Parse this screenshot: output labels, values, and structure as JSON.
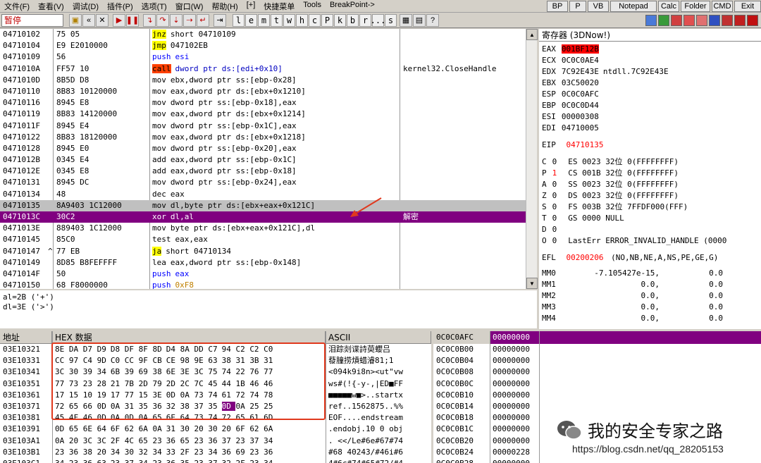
{
  "menu": {
    "items": [
      "文件(F)",
      "查看(V)",
      "调试(D)",
      "插件(P)",
      "选项(T)",
      "窗口(W)",
      "帮助(H)",
      "[+]",
      "快捷菜单",
      "Tools",
      "BreakPoint->"
    ],
    "right_buttons": [
      "BP",
      "P",
      "VB",
      "Notepad",
      "Calc",
      "Folder",
      "CMD",
      "Exit"
    ]
  },
  "toolbar": {
    "status": "暂停",
    "letters": [
      "l",
      "e",
      "m",
      "t",
      "w",
      "h",
      "c",
      "P",
      "k",
      "b",
      "r",
      "...",
      "s"
    ]
  },
  "disasm": {
    "rows": [
      {
        "addr": "04710102",
        "mark": "",
        "hex": "75 05",
        "mn": "jnz",
        "ops": "short 04710109",
        "cmt": "",
        "style": "jmp"
      },
      {
        "addr": "04710104",
        "mark": "",
        "hex": "E9 E2010000",
        "mn": "jmp",
        "ops": "047102EB",
        "cmt": "",
        "style": "jmp"
      },
      {
        "addr": "04710109",
        "mark": "",
        "hex": "56",
        "mn": "push",
        "ops": "esi",
        "cmt": "",
        "style": "push"
      },
      {
        "addr": "0471010A",
        "mark": "",
        "hex": "FF57 10",
        "mn": "call",
        "ops": "dword ptr ds:[edi+0x10]",
        "cmt": "kernel32.CloseHandle",
        "style": "call"
      },
      {
        "addr": "0471010D",
        "mark": "",
        "hex": "8B5D D8",
        "mn": "mov",
        "ops": "ebx,dword ptr ss:[ebp-0x28]",
        "cmt": "",
        "style": ""
      },
      {
        "addr": "04710110",
        "mark": "",
        "hex": "8B83 10120000",
        "mn": "mov",
        "ops": "eax,dword ptr ds:[ebx+0x1210]",
        "cmt": "",
        "style": ""
      },
      {
        "addr": "04710116",
        "mark": "",
        "hex": "8945 E8",
        "mn": "mov",
        "ops": "dword ptr ss:[ebp-0x18],eax",
        "cmt": "",
        "style": ""
      },
      {
        "addr": "04710119",
        "mark": "",
        "hex": "8B83 14120000",
        "mn": "mov",
        "ops": "eax,dword ptr ds:[ebx+0x1214]",
        "cmt": "",
        "style": ""
      },
      {
        "addr": "0471011F",
        "mark": "",
        "hex": "8945 E4",
        "mn": "mov",
        "ops": "dword ptr ss:[ebp-0x1C],eax",
        "cmt": "",
        "style": ""
      },
      {
        "addr": "04710122",
        "mark": "",
        "hex": "8B83 18120000",
        "mn": "mov",
        "ops": "eax,dword ptr ds:[ebx+0x1218]",
        "cmt": "",
        "style": ""
      },
      {
        "addr": "04710128",
        "mark": "",
        "hex": "8945 E0",
        "mn": "mov",
        "ops": "dword ptr ss:[ebp-0x20],eax",
        "cmt": "",
        "style": ""
      },
      {
        "addr": "0471012B",
        "mark": "",
        "hex": "0345 E4",
        "mn": "add",
        "ops": "eax,dword ptr ss:[ebp-0x1C]",
        "cmt": "",
        "style": ""
      },
      {
        "addr": "0471012E",
        "mark": "",
        "hex": "0345 E8",
        "mn": "add",
        "ops": "eax,dword ptr ss:[ebp-0x18]",
        "cmt": "",
        "style": ""
      },
      {
        "addr": "04710131",
        "mark": "",
        "hex": "8945 DC",
        "mn": "mov",
        "ops": "dword ptr ss:[ebp-0x24],eax",
        "cmt": "",
        "style": ""
      },
      {
        "addr": "04710134",
        "mark": "",
        "hex": "48",
        "mn": "dec",
        "ops": "eax",
        "cmt": "",
        "style": ""
      },
      {
        "addr": "04710135",
        "mark": "",
        "hex": "8A9403 1C12000",
        "mn": "mov",
        "ops": "dl,byte ptr ds:[ebx+eax+0x121C]",
        "cmt": "",
        "style": "cur"
      },
      {
        "addr": "0471013C",
        "mark": "",
        "hex": "30C2",
        "mn": "xor",
        "ops": "dl,al",
        "cmt": "解密",
        "style": "sel"
      },
      {
        "addr": "0471013E",
        "mark": "",
        "hex": "889403 1C12000",
        "mn": "mov",
        "ops": "byte ptr ds:[ebx+eax+0x121C],dl",
        "cmt": "",
        "style": ""
      },
      {
        "addr": "04710145",
        "mark": "",
        "hex": "85C0",
        "mn": "test",
        "ops": "eax,eax",
        "cmt": "",
        "style": ""
      },
      {
        "addr": "04710147",
        "mark": "^",
        "hex": "77 EB",
        "mn": "ja",
        "ops": "short 04710134",
        "cmt": "",
        "style": "jmp"
      },
      {
        "addr": "04710149",
        "mark": "",
        "hex": "8D85 B8FEFFFF",
        "mn": "lea",
        "ops": "eax,dword ptr ss:[ebp-0x148]",
        "cmt": "",
        "style": ""
      },
      {
        "addr": "0471014F",
        "mark": "",
        "hex": "50",
        "mn": "push",
        "ops": "eax",
        "cmt": "",
        "style": "push"
      },
      {
        "addr": "04710150",
        "mark": "",
        "hex": "68 F8000000",
        "mn": "push",
        "ops": "0xF8",
        "cmt": "",
        "style": "push"
      }
    ]
  },
  "info": {
    "line1": "al=2B ('+')",
    "line2": "dl=3E ('>')"
  },
  "registers": {
    "title": "寄存器 (3DNow!)",
    "gp": [
      {
        "name": "EAX",
        "value": "001BF12B",
        "extra": "",
        "hl": true
      },
      {
        "name": "ECX",
        "value": "0C0C0AE4",
        "extra": "",
        "hl": false
      },
      {
        "name": "EDX",
        "value": "7C92E43E",
        "extra": "ntdll.7C92E43E",
        "hl": false
      },
      {
        "name": "EBX",
        "value": "03C50020",
        "extra": "",
        "hl": false
      },
      {
        "name": "ESP",
        "value": "0C0C0AFC",
        "extra": "",
        "hl": false
      },
      {
        "name": "EBP",
        "value": "0C0C0D44",
        "extra": "",
        "hl": false
      },
      {
        "name": "ESI",
        "value": "00000308",
        "extra": "",
        "hl": false
      },
      {
        "name": "EDI",
        "value": "04710005",
        "extra": "",
        "hl": false
      }
    ],
    "eip_name": "EIP",
    "eip": "04710135",
    "flags": [
      {
        "f": "C",
        "v": "0",
        "seg": "ES 0023 32位 0(FFFFFFFF)"
      },
      {
        "f": "P",
        "v": "1",
        "seg": "CS 001B 32位 0(FFFFFFFF)"
      },
      {
        "f": "A",
        "v": "0",
        "seg": "SS 0023 32位 0(FFFFFFFF)"
      },
      {
        "f": "Z",
        "v": "0",
        "seg": "DS 0023 32位 0(FFFFFFFF)"
      },
      {
        "f": "S",
        "v": "0",
        "seg": "FS 003B 32位 7FFDF000(FFF)"
      },
      {
        "f": "T",
        "v": "0",
        "seg": "GS 0000 NULL"
      },
      {
        "f": "D",
        "v": "0",
        "seg": ""
      },
      {
        "f": "O",
        "v": "0",
        "seg": "LastErr ERROR_INVALID_HANDLE (0000"
      }
    ],
    "efl_name": "EFL",
    "efl": "00200206",
    "efl_desc": "(NO,NB,NE,A,NS,PE,GE,G)",
    "mm": [
      {
        "name": "MM0",
        "a": "-7.105427e-15,",
        "b": "0.0"
      },
      {
        "name": "MM1",
        "a": "0.0,",
        "b": "0.0"
      },
      {
        "name": "MM2",
        "a": "0.0,",
        "b": "0.0"
      },
      {
        "name": "MM3",
        "a": "0.0,",
        "b": "0.0"
      },
      {
        "name": "MM4",
        "a": "0.0,",
        "b": "0.0"
      }
    ]
  },
  "hex": {
    "col_addr": "地址",
    "col_hex": "HEX 数据",
    "col_ascii": "ASCII",
    "rows": [
      {
        "addr": "03E10321",
        "bytes": "8E DA D7 D9|D8 DF 8F 8D|D4 8A DD C7|94 C2 C2 C0",
        "ascii": "泪踪剡谍詩萸蠳吕"
      },
      {
        "addr": "03E10331",
        "bytes": "CC 97 C4 9D|C0 CC 9F CB|CE 98 9E 63|38 31 3B 31",
        "ascii": "蕟膧捞熕蜡濬81;1"
      },
      {
        "addr": "03E10341",
        "bytes": "3C 30 39 34|6B 39 69 38|6E 3E 3C 75|74 22 76 77",
        "ascii": "<094k9i8n><ut\"vw"
      },
      {
        "addr": "03E10351",
        "bytes": "77 73 23 28|21 7B 2D 79|2D 2C 7C 45|44 1B 46 46",
        "ascii": "ws#(!{-y-,|ED■FF"
      },
      {
        "addr": "03E10361",
        "bytes": "17 15 10 19|17 77 15 3E|0D 0A 73 74|61 72 74 78",
        "ascii": "■■■■■w■>..startx"
      },
      {
        "addr": "03E10371",
        "bytes": "72 65 66 0D|0A 31 35 36|32 38 37 35|0D 0A 25 25",
        "ascii": "ref..1562875..%%"
      },
      {
        "addr": "03E10381",
        "bytes": "45 4F 46 0D|0A 0D 0A 65|6E 64 73 74|72 65 61 6D",
        "ascii": "EOF....endstream"
      },
      {
        "addr": "03E10391",
        "bytes": "0D 65 6E 64|6F 62 6A 0A|31 30 20 30|20 6F 62 6A",
        "ascii": ".endobj.10 0 obj"
      },
      {
        "addr": "03E103A1",
        "bytes": "0A 20 3C 3C|2F 4C 65 23|36 65 23 36|37 23 37 34",
        "ascii": ". <</Le#6e#67#74"
      },
      {
        "addr": "03E103B1",
        "bytes": "23 36 38 20|34 30 32 34|33 2F 23 34|36 69 23 36",
        "ascii": "#68 40243/#46i#6"
      },
      {
        "addr": "03E103C1",
        "bytes": "34 23 36 63|23 37 34 23|36 35 23 37|32 2F 23 34",
        "ascii": "4#6c#74#65#72/#4"
      }
    ]
  },
  "stack": {
    "top_addr": "0C0C0AFC",
    "top_val": "00000000",
    "rows": [
      {
        "addr": "0C0C0B00",
        "val": "00000000"
      },
      {
        "addr": "0C0C0B04",
        "val": "00000000"
      },
      {
        "addr": "0C0C0B08",
        "val": "00000000"
      },
      {
        "addr": "0C0C0B0C",
        "val": "00000000"
      },
      {
        "addr": "0C0C0B10",
        "val": "00000000"
      },
      {
        "addr": "0C0C0B14",
        "val": "00000000"
      },
      {
        "addr": "0C0C0B18",
        "val": "00000000"
      },
      {
        "addr": "0C0C0B1C",
        "val": "00000000"
      },
      {
        "addr": "0C0C0B20",
        "val": "00000000"
      },
      {
        "addr": "0C0C0B24",
        "val": "00000228"
      },
      {
        "addr": "0C0C0B28",
        "val": "00000000"
      }
    ]
  },
  "watermark": {
    "text": "我的安全专家之路",
    "url": "https://blog.csdn.net/qq_28205153"
  },
  "colors": {
    "selection": "#800080",
    "eax_highlight": "#ff0000",
    "annotation": "#e0391e"
  },
  "icons": [
    "open-icon",
    "rewind-icon",
    "close-icon",
    "run-icon",
    "pause-icon",
    "step-into-icon",
    "step-over-icon",
    "trace-into-icon",
    "trace-over-icon",
    "execute-till-return-icon",
    "goto-icon"
  ]
}
